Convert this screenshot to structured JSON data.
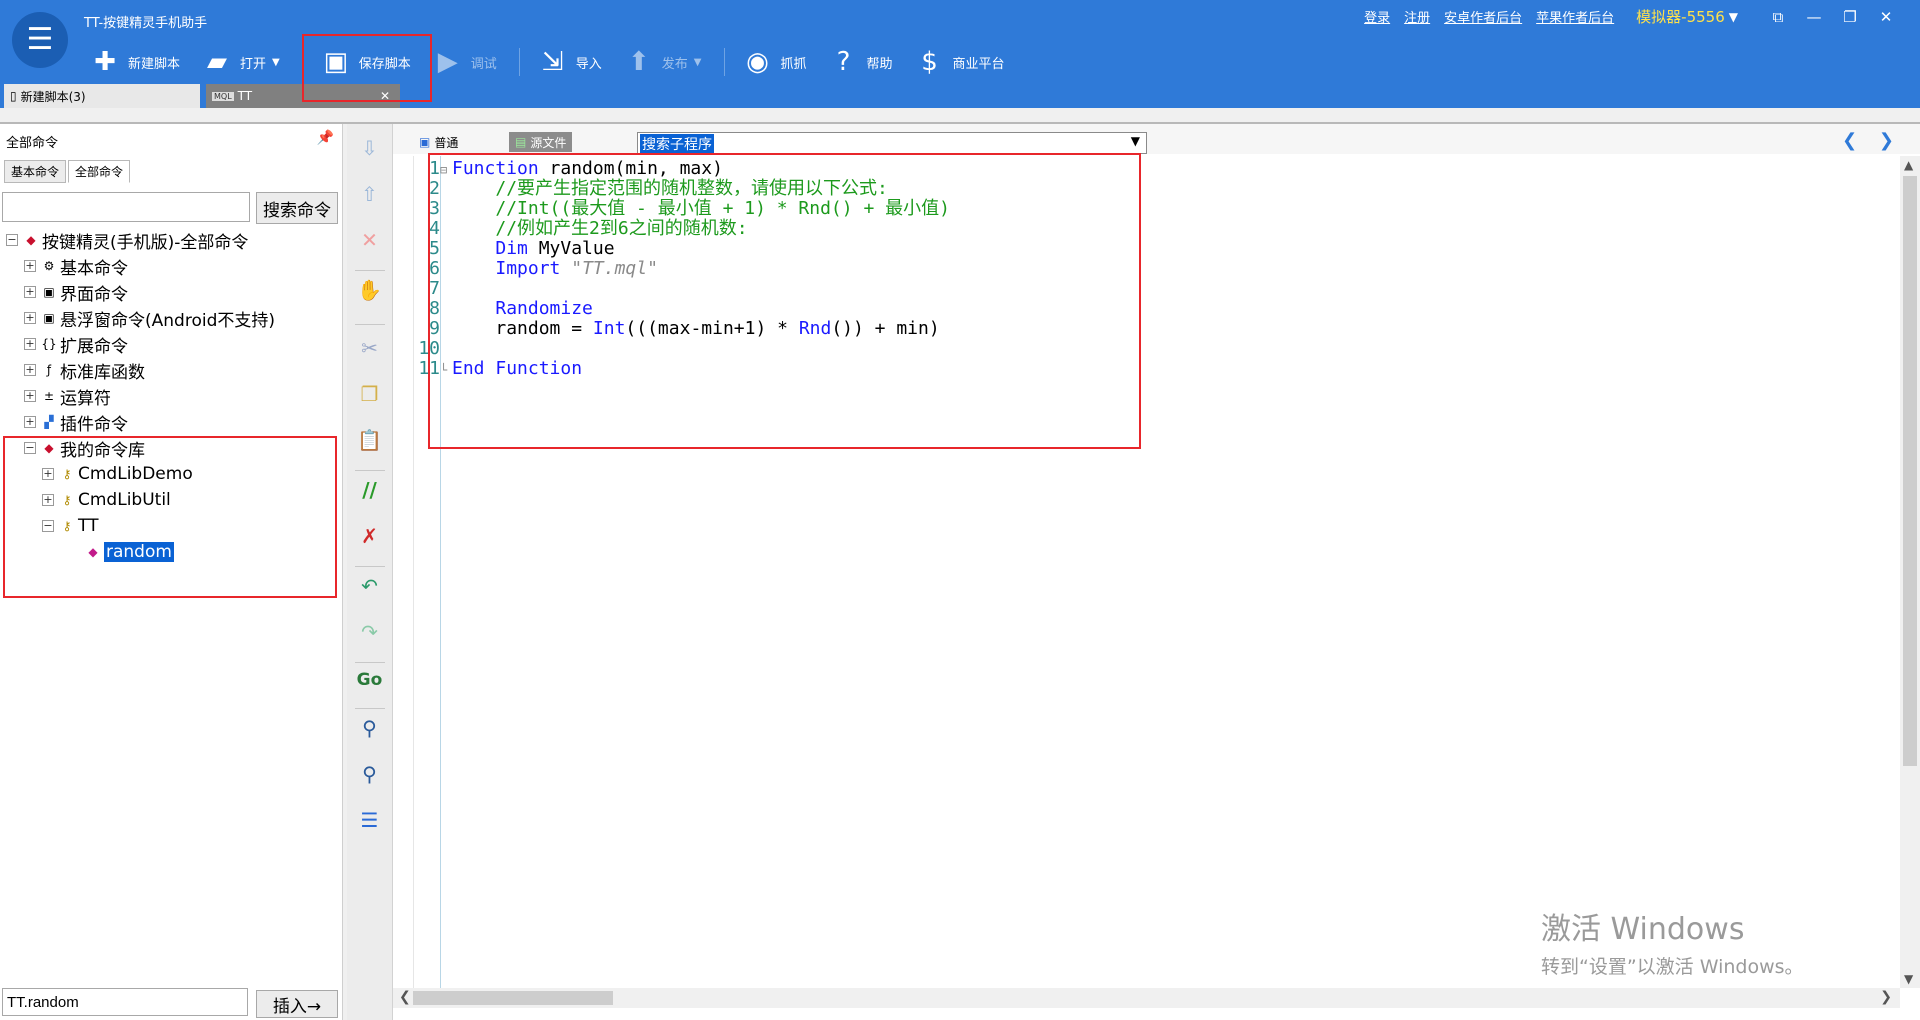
{
  "window": {
    "title": "TT-按键精灵手机助手",
    "logo_glyph": "☰",
    "top_links": [
      "登录",
      "注册",
      "安卓作者后台",
      "苹果作者后台"
    ],
    "emulator": "模拟器-5556",
    "controls": {
      "restore_small": "⧉",
      "minimize": "—",
      "maximize": "❐",
      "close": "✕"
    }
  },
  "toolbar": {
    "new_script": "新建脚本",
    "open": "打开",
    "save_script": "保存脚本",
    "debug": "调试",
    "import": "导入",
    "publish": "发布",
    "capture": "抓抓",
    "help": "帮助",
    "business": "商业平台"
  },
  "doc_tabs": [
    {
      "label": "新建脚本(3)"
    },
    {
      "label": "TT",
      "icon_label": "MQL"
    }
  ],
  "left_panel": {
    "title": "全部命令",
    "tabs": [
      "基本命令",
      "全部命令"
    ],
    "search_value": "",
    "search_button": "搜索命令",
    "tree": {
      "root": "按键精灵(手机版)-全部命令",
      "items": [
        "基本命令",
        "界面命令",
        "悬浮窗命令(Android不支持)",
        "扩展命令",
        "标准库函数",
        "运算符",
        "插件命令",
        "我的命令库"
      ],
      "mylib_children": [
        "CmdLibDemo",
        "CmdLibUtil",
        "TT"
      ],
      "selected_leaf": "random"
    },
    "bottom_value": "TT.random",
    "insert_button": "插入→"
  },
  "editor": {
    "tabs": [
      "普通",
      "源文件"
    ],
    "sub_select": "搜索子程序",
    "line_numbers": [
      "1",
      "2",
      "3",
      "4",
      "5",
      "6",
      "7",
      "8",
      "9",
      "10",
      "11"
    ],
    "lines": {
      "l1_kw": "Function",
      "l1_rest": " random(min, max)",
      "l2": "//要产生指定范围的随机整数，请使用以下公式:",
      "l3": "//Int((最大值 - 最小值 + 1) * Rnd() + 最小值)",
      "l4": "//例如产生2到6之间的随机数:",
      "l5_kw": "Dim",
      "l5_rest": " MyValue",
      "l6_kw": "Import",
      "l6_str": "\"TT.mql\"",
      "l8_kw": "Randomize",
      "l9_a": "random = ",
      "l9_int": "Int",
      "l9_b": "(((max-min+1) * ",
      "l9_rnd": "Rnd",
      "l9_c": "()) + min)",
      "l11_kw1": "End",
      "l11_kw2": "Function"
    }
  },
  "watermark": {
    "line1": "激活 Windows",
    "line2": "转到“设置”以激活 Windows。"
  },
  "colors": {
    "titlebar": "#2f7ad8",
    "highlight_box": "#e8262b",
    "keyword": "#1a1aff",
    "comment": "#1d9a1d",
    "selection": "#0a62d4"
  }
}
